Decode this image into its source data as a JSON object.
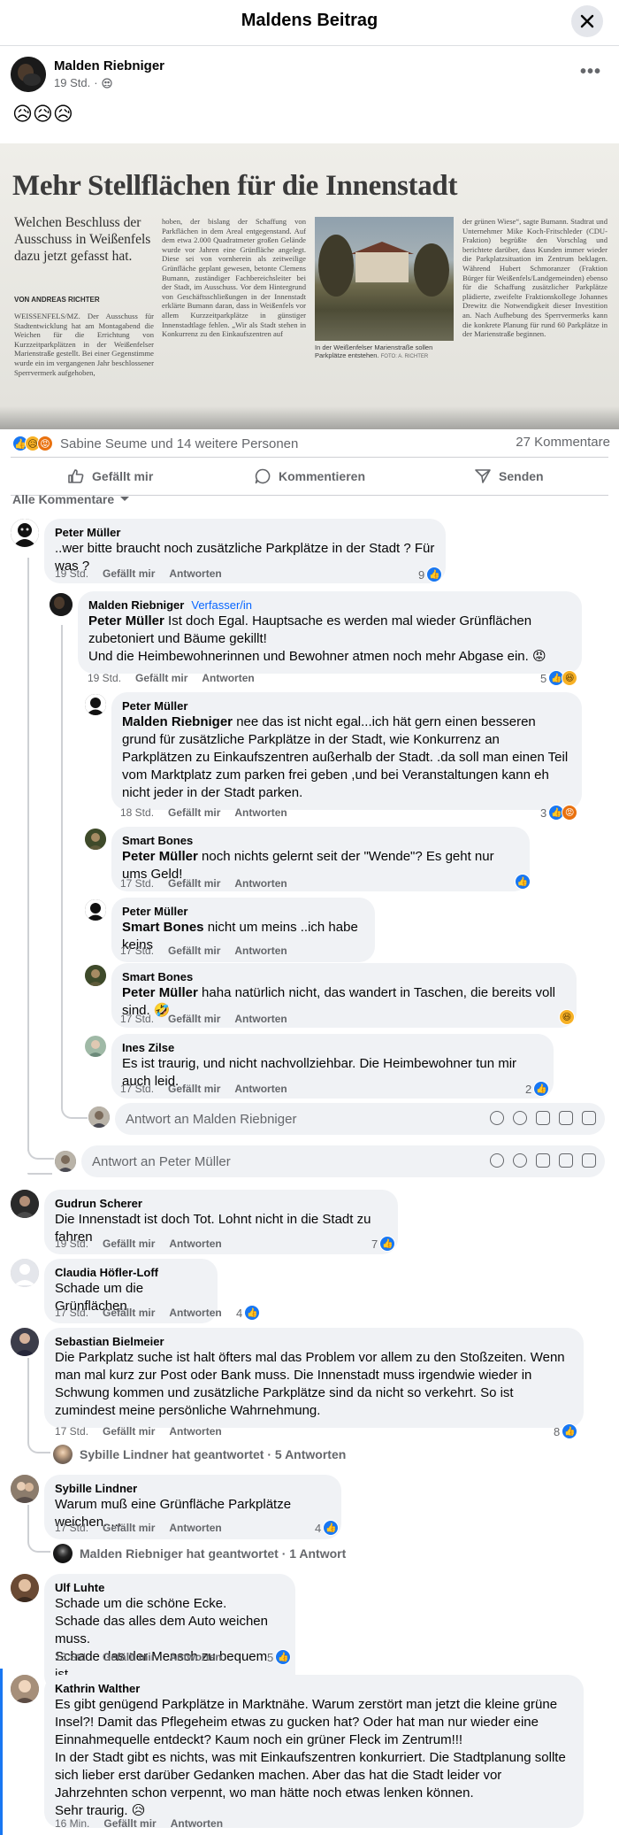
{
  "header": {
    "title": "Maldens Beitrag"
  },
  "post": {
    "author": "Malden Riebniger",
    "time": "19 Std.",
    "separator": "·",
    "text": "😥😥😥",
    "image": {
      "headline": "Mehr Stellflächen für die Innenstadt",
      "sub": "Welchen Beschluss der Ausschuss in Weißenfels dazu jetzt gefasst hat.",
      "byline": "VON ANDREAS RICHTER",
      "col1": "WEISSENFELS/MZ. Der Ausschuss für Stadtentwicklung hat am Montagabend die Weichen für die Errichtung von Kurzzeitparkplätzen in der Weißenfelser Marienstraße gestellt. Bei einer Gegenstimme wurde ein im vergangenen Jahr beschlossener Sperrvermerk aufgehoben,",
      "col2": "hoben, der bislang der Schaffung von Parkflächen in dem Areal entgegenstand. Auf dem etwa 2.000 Quadratmeter großen Gelände wurde vor Jahren eine Grünfläche angelegt. Diese sei von vornherein als zeitweilige Grünfläche geplant gewesen, betonte Clemens Bumann, zuständiger Fachbereichsleiter bei der Stadt, im Ausschuss. Vor dem Hintergrund von Geschäftsschließungen in der Innenstadt erklärte Bumann daran, dass in Weißenfels vor allem Kurzzeitparkplätze in günstiger Innenstadtlage fehlen. „Wir als Stadt stehen in Konkurrenz zu den Einkaufszentren auf",
      "col3": "der grünen Wiese“, sagte Bumann. Stadtrat und Unternehmer Mike Koch-Fritschleder (CDU-Fraktion) begrüßte den Vorschlag und berichtete darüber, dass Kunden immer wieder die Parkplatzsituation im Zentrum beklagen. Während Hubert Schmoranzer (Fraktion Bürger für Weißenfels/Landgemeinden) ebenso für die Schaffung zusätzlicher Parkplätze plädierte, zweifelte Fraktionskollege Johannes Drewitz die Notwendigkeit dieser Investition an. Nach Aufhebung des Sperrvermerks kann die konkrete Planung für rund 60 Parkplätze in der Marienstraße beginnen.",
      "caption": "In der Weißenfelser Marienstraße sollen Parkplätze entstehen.",
      "photo_credit": "FOTO: A. RICHTER"
    },
    "reactions_text": "Sabine Seume und 14 weitere Personen",
    "comments_count": "27 Kommentare"
  },
  "actions": {
    "like": "Gefällt mir",
    "comment": "Kommentieren",
    "share": "Senden"
  },
  "sort_label": "Alle Kommentare",
  "comments": [
    {
      "name": "Peter Müller",
      "text": "..wer bitte braucht noch zusätzliche Parkplätze in der Stadt ? Für was ?",
      "time": "19 Std.",
      "like": "Gefällt mir",
      "reply": "Antworten",
      "count": "9"
    },
    {
      "name": "Malden Riebniger",
      "badge": "Verfasser/in",
      "mention": "Peter Müller",
      "text": " Ist doch Egal. Hauptsache es werden mal wieder Grünflächen zubetoniert und Bäume gekillt!",
      "text2": "Und die Heimbewohnerinnen und Bewohner atmen noch mehr Abgase ein. 😡",
      "time": "19 Std.",
      "like": "Gefällt mir",
      "reply": "Antworten",
      "count": "5"
    },
    {
      "name": "Peter Müller",
      "mention": "Malden Riebniger",
      "text": " nee das ist nicht egal...ich hät gern einen besseren grund für zusätzliche Parkplätze in der Stadt, wie Konkurrenz an Parkplätzen zu Einkaufszentren außerhalb der Stadt. .da soll man einen Teil vom Marktplatz zum parken frei geben ,und bei Veranstaltungen kann eh nicht jeder in der Stadt parken.",
      "time": "18 Std.",
      "like": "Gefällt mir",
      "reply": "Antworten",
      "count": "3"
    },
    {
      "name": "Smart Bones",
      "mention": "Peter Müller",
      "text": " noch nichts gelernt seit der \"Wende\"? Es geht nur ums Geld!",
      "time": "17 Std.",
      "like": "Gefällt mir",
      "reply": "Antworten"
    },
    {
      "name": "Peter Müller",
      "mention": "Smart Bones",
      "text": " nicht um meins ..ich habe keins",
      "time": "17 Std.",
      "like": "Gefällt mir",
      "reply": "Antworten"
    },
    {
      "name": "Smart Bones",
      "mention": "Peter Müller",
      "text": " haha natürlich nicht, das wandert in Taschen, die bereits voll sind. 🤣",
      "time": "17 Std.",
      "like": "Gefällt mir",
      "reply": "Antworten"
    },
    {
      "name": "Ines Zilse",
      "text": "Es ist traurig, und nicht nachvollziehbar. Die Heimbewohner tun mir auch leid.",
      "time": "17 Std.",
      "like": "Gefällt mir",
      "reply": "Antworten",
      "count": "2"
    },
    {
      "name": "Gudrun Scherer",
      "text": "Die Innenstadt ist doch Tot. Lohnt nicht in die Stadt zu fahren",
      "time": "19 Std.",
      "like": "Gefällt mir",
      "reply": "Antworten",
      "count": "7"
    },
    {
      "name": "Claudia Höfler-Loff",
      "text": "Schade um die Grünflächen",
      "time": "17 Std.",
      "like": "Gefällt mir",
      "reply": "Antworten",
      "count": "4"
    },
    {
      "name": "Sebastian Bielmeier",
      "text": "Die Parkplatz suche ist halt öfters mal das Problem vor allem zu den Stoßzeiten. Wenn man mal kurz zur Post oder Bank muss. Die Innenstadt muss irgendwie wieder in Schwung kommen und zusätzliche Parkplätze sind da nicht so verkehrt. So ist zumindest meine persönliche Wahrnehmung.",
      "time": "17 Std.",
      "like": "Gefällt mir",
      "reply": "Antworten",
      "count": "8"
    },
    {
      "name": "Sybille Lindner",
      "text": "Warum muß eine Grünfläche Parkplätze weichen.....",
      "time": "17 Std.",
      "like": "Gefällt mir",
      "reply": "Antworten",
      "count": "4"
    },
    {
      "name": "Ulf Luhte",
      "text": "Schade um die schöne Ecke.",
      "text2": "Schade das alles dem Auto weichen muss.",
      "text3": "Schade das der Mensch zu bequem ist.",
      "time": "13 Std.",
      "like": "Gefällt mir",
      "reply": "Antworten",
      "count": "5"
    },
    {
      "name": "Kathrin Walther",
      "text": "Es gibt genügend Parkplätze in Marktnähe. Warum zerstört man jetzt die kleine grüne Insel?! Damit das Pflegeheim etwas zu gucken hat? Oder hat man nur wieder eine Einnahmequelle entdeckt? Kaum noch ein grüner Fleck im Zentrum!!!",
      "text2": "In der Stadt gibt es nichts, was mit Einkaufszentren konkurriert. Die Stadtplanung sollte sich lieber erst darüber Gedanken machen. Aber das hat die Stadt leider vor Jahrzehnten schon verpennt, wo man hätte noch etwas lenken können.",
      "text3": "Sehr traurig. 😥",
      "time": "16 Min.",
      "like": "Gefällt mir",
      "reply": "Antworten"
    }
  ],
  "reply_boxes": {
    "malden": "Antwort an Malden Riebniger",
    "peter": "Antwort an Peter Müller"
  },
  "replied_lines": {
    "sybille": "Sybille Lindner hat geantwortet · 5 Antworten",
    "malden": "Malden Riebniger hat geantwortet · 1 Antwort"
  }
}
